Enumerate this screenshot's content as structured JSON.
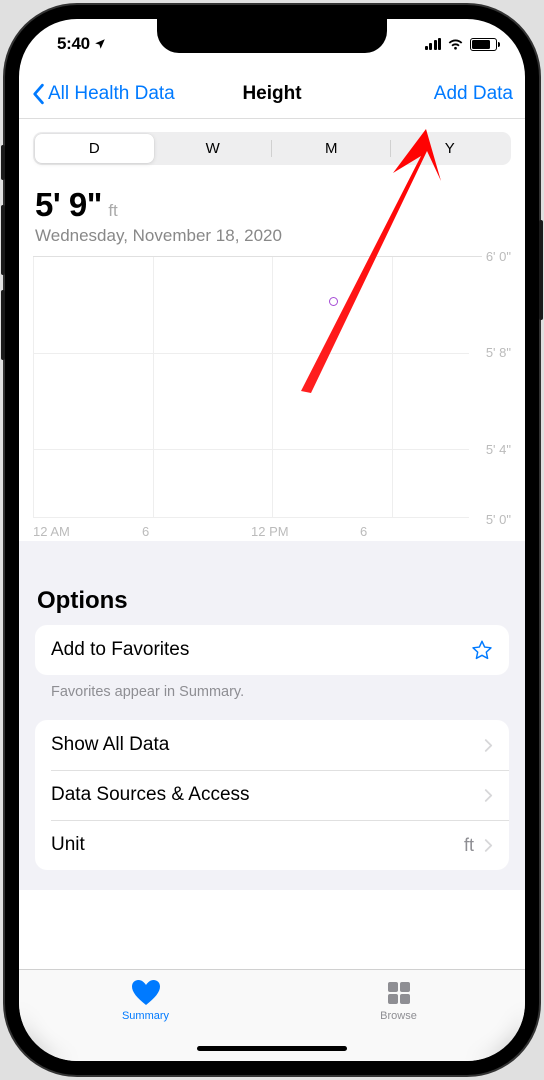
{
  "status": {
    "time": "5:40"
  },
  "nav": {
    "back": "All Health Data",
    "title": "Height",
    "add": "Add Data"
  },
  "segment": {
    "items": [
      "D",
      "W",
      "M",
      "Y"
    ],
    "selected": 0
  },
  "measurement": {
    "value": "5' 9\"",
    "unit": "ft",
    "date": "Wednesday, November 18, 2020"
  },
  "chart_data": {
    "type": "scatter",
    "title": "Height",
    "xlabel": "",
    "ylabel": "",
    "x_ticks": [
      "12 AM",
      "6",
      "12 PM",
      "6"
    ],
    "y_ticks": [
      "6' 0\"",
      "5' 8\"",
      "5' 4\"",
      "5' 0\""
    ],
    "ylim_inches": [
      60,
      72
    ],
    "series": [
      {
        "name": "Height",
        "points": [
          {
            "time_hours": 14,
            "value_inches": 69
          }
        ]
      }
    ]
  },
  "options": {
    "heading": "Options",
    "favorites": "Add to Favorites",
    "fav_footnote": "Favorites appear in Summary.",
    "show_all": "Show All Data",
    "sources": "Data Sources & Access",
    "unit_label": "Unit",
    "unit_value": "ft"
  },
  "tabs": {
    "summary": "Summary",
    "browse": "Browse"
  }
}
